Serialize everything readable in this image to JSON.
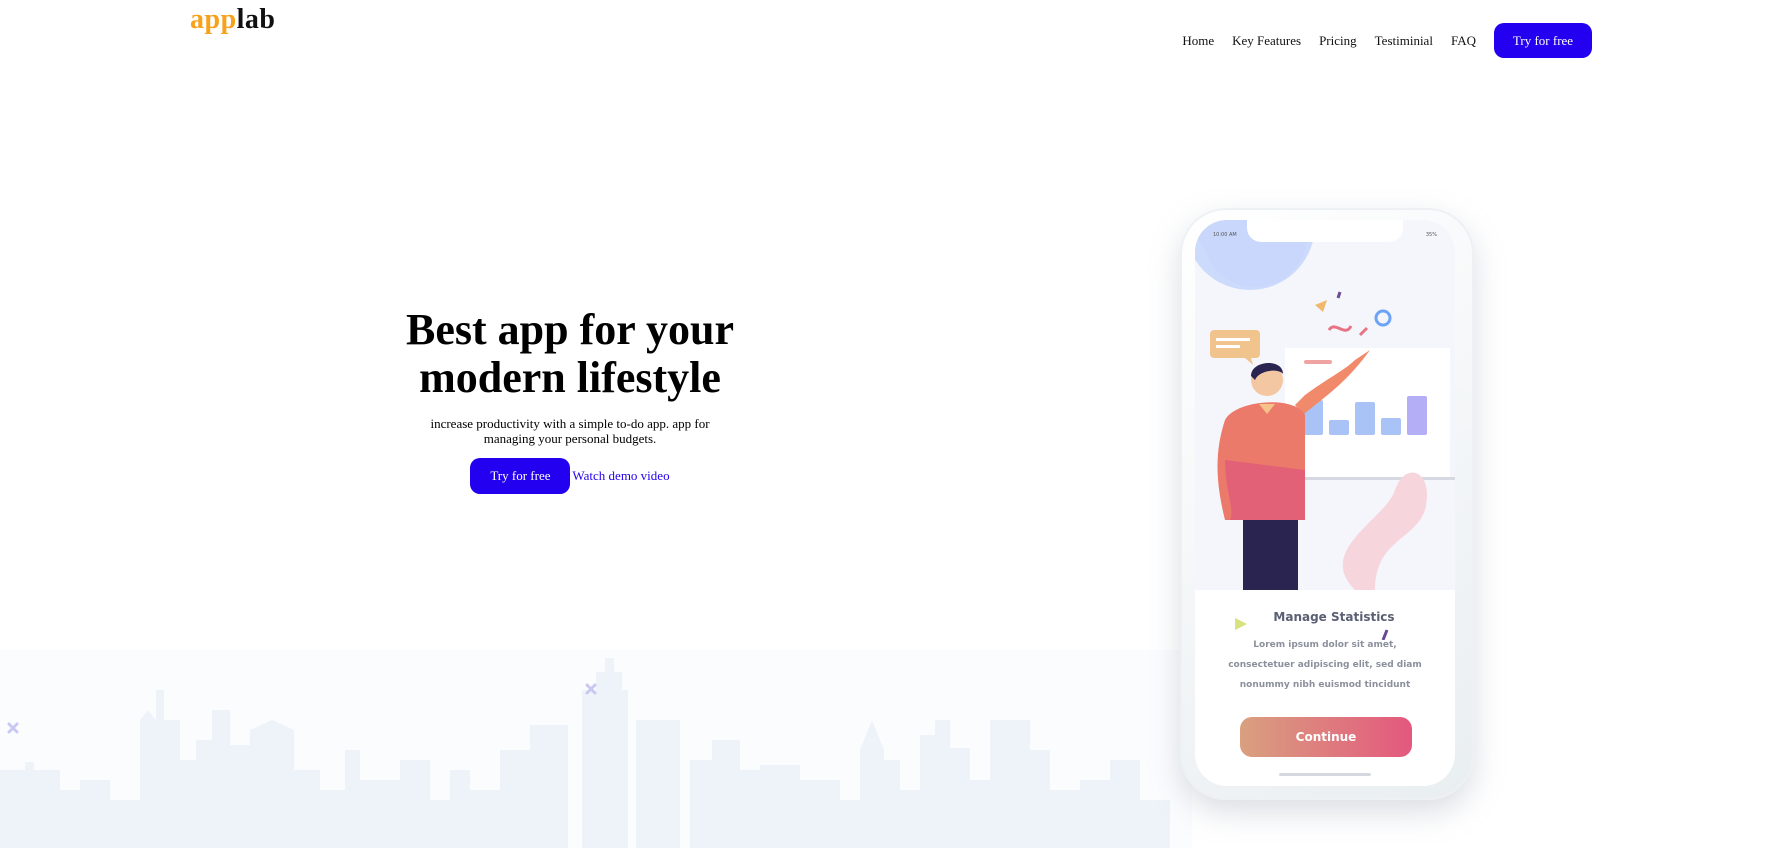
{
  "header": {
    "logo_part1": "app",
    "logo_part2": "lab",
    "nav": [
      "Home",
      "Key Features",
      "Pricing",
      "Testiminial",
      "FAQ"
    ],
    "cta": "Try for free"
  },
  "hero": {
    "title_line1": "Best app for your",
    "title_line2": "modern lifestyle",
    "subtitle": "increase productivity with a simple to-do app. app for managing your personal budgets.",
    "primary_button": "Try for free",
    "secondary_link": "Watch demo video"
  },
  "phone": {
    "time": "10:00 AM",
    "battery": "35%",
    "card_title": "Manage Statistics",
    "card_text": "Lorem ipsum dolor sit amet, consectetuer adipiscing elit, sed diam nonummy nibh euismod tincidunt",
    "button": "Continue"
  },
  "colors": {
    "accent": "#2300f0",
    "logo_orange": "#f7a21b",
    "skyline": "#eef3fa",
    "phone_button_start": "#d9a07f",
    "phone_button_end": "#e3587e"
  }
}
